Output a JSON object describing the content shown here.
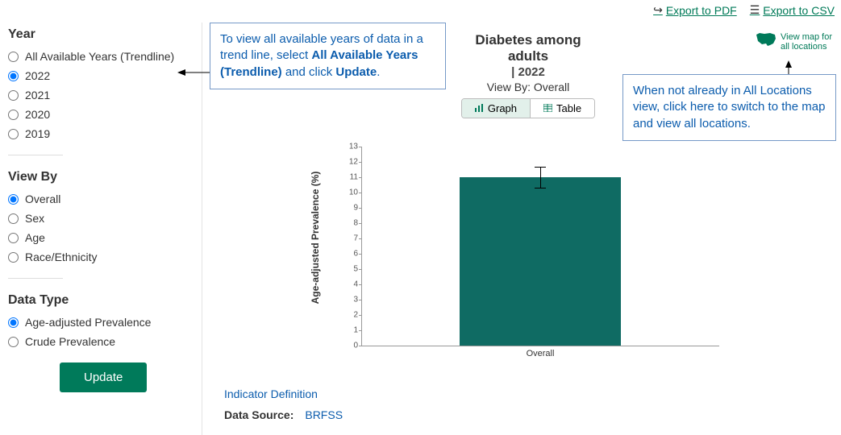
{
  "export": {
    "pdf_label": "Export to PDF",
    "csv_label": "Export to CSV"
  },
  "sidebar": {
    "year_heading": "Year",
    "years": [
      {
        "label": "All Available Years (Trendline)",
        "selected": false
      },
      {
        "label": "2022",
        "selected": true
      },
      {
        "label": "2021",
        "selected": false
      },
      {
        "label": "2020",
        "selected": false
      },
      {
        "label": "2019",
        "selected": false
      }
    ],
    "viewby_heading": "View By",
    "viewby": [
      {
        "label": "Overall",
        "selected": true
      },
      {
        "label": "Sex",
        "selected": false
      },
      {
        "label": "Age",
        "selected": false
      },
      {
        "label": "Race/Ethnicity",
        "selected": false
      }
    ],
    "datatype_heading": "Data Type",
    "datatype": [
      {
        "label": "Age-adjusted Prevalence",
        "selected": true
      },
      {
        "label": "Crude Prevalence",
        "selected": false
      }
    ],
    "update_label": "Update"
  },
  "callouts": {
    "c1_pre": "To view all available years of data in a trend line, select ",
    "c1_b1": "All Available Years (Trendline)",
    "c1_mid": " and click ",
    "c1_b2": "Update",
    "c1_post": ".",
    "c2": "When not already in All Locations view, click here to switch to the map and view all locations."
  },
  "header": {
    "title": "Diabetes among adults",
    "subtitle": "|  2022",
    "viewby_text": "View By: Overall",
    "graph_label": "Graph",
    "table_label": "Table"
  },
  "maplink": {
    "label": "View map for all locations"
  },
  "footer": {
    "indicator_label": "Indicator Definition",
    "ds_label": "Data Source:",
    "ds_value": "BRFSS"
  },
  "chart_data": {
    "type": "bar",
    "ylabel": "Age-adjusted Prevalence (%)",
    "ylim": [
      0,
      13
    ],
    "yticks": [
      0,
      1,
      2,
      3,
      4,
      5,
      6,
      7,
      8,
      9,
      10,
      11,
      12,
      13
    ],
    "categories": [
      "Overall"
    ],
    "values": [
      11.0
    ],
    "error_low": [
      10.3
    ],
    "error_high": [
      11.7
    ]
  }
}
